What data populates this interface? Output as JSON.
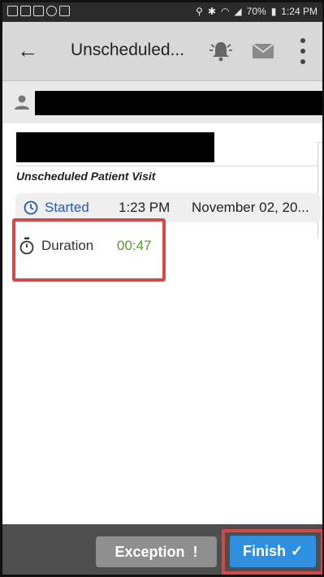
{
  "status_bar": {
    "battery": "70%",
    "time": "1:24 PM"
  },
  "toolbar": {
    "title": "Unscheduled..."
  },
  "visit": {
    "title": "Unscheduled Patient Visit",
    "started_label": "Started",
    "started_time": "1:23 PM",
    "started_date": "November 02, 20...",
    "duration_label": "Duration",
    "duration_value": "00:47"
  },
  "actions": {
    "exception_label": "Exception",
    "exception_glyph": "!",
    "finish_label": "Finish",
    "finish_glyph": "✓"
  },
  "colors": {
    "toolbar_bg": "#d8d8d8",
    "started_text": "#2a5aa8",
    "duration_value": "#5b9a2f",
    "finish_bg": "#2f8fe0",
    "highlight": "#d04a4a"
  }
}
